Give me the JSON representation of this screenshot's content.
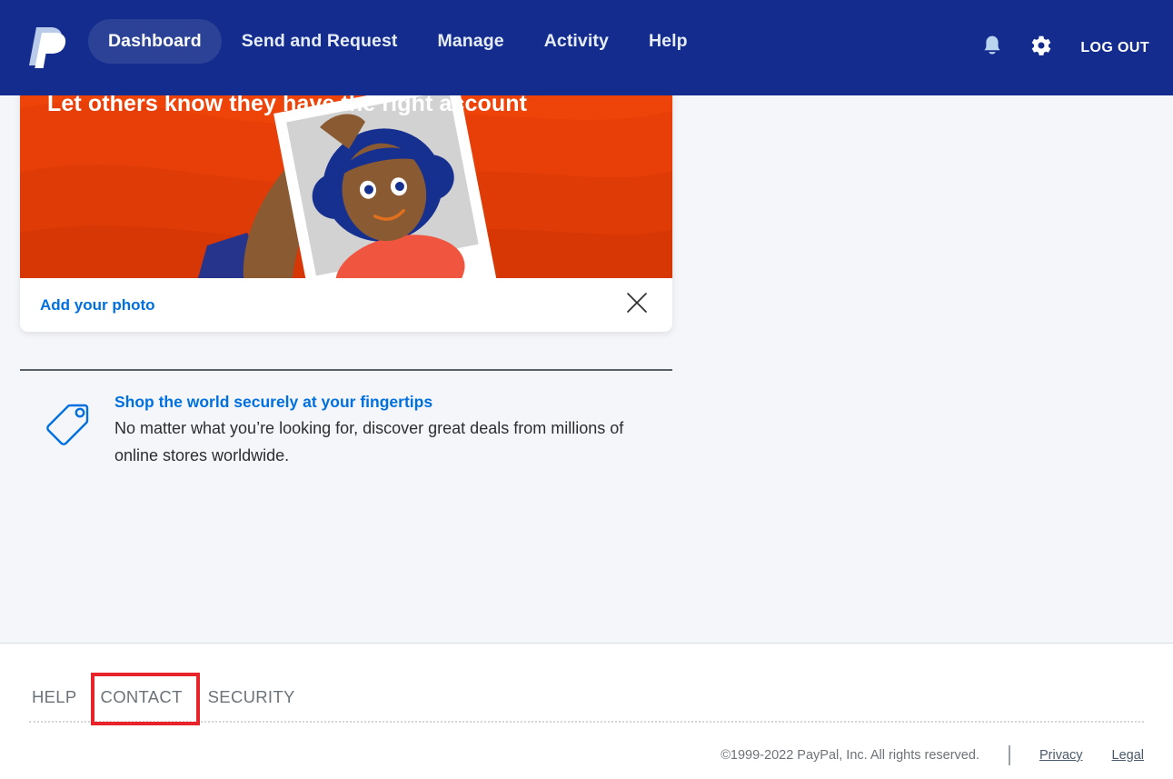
{
  "nav": {
    "logo": "paypal-logo",
    "items": [
      {
        "label": "Dashboard",
        "active": true
      },
      {
        "label": "Send and Request",
        "active": false
      },
      {
        "label": "Manage",
        "active": false
      },
      {
        "label": "Activity",
        "active": false
      },
      {
        "label": "Help",
        "active": false
      }
    ],
    "notifications_icon": "bell-icon",
    "settings_icon": "gear-icon",
    "logout_label": "LOG OUT",
    "background_color": "#142c8e",
    "active_pill_color": "#2b4296"
  },
  "promo": {
    "title": "Let others know they have the right account",
    "link_label": "Add your photo",
    "close_icon": "close-icon",
    "hero_color": "#ef4409"
  },
  "feature": {
    "icon": "price-tag-icon",
    "title": "Shop the world securely at your fingertips",
    "body": "No matter what you’re looking for, discover great deals from millions of online stores worldwide."
  },
  "footer": {
    "links": [
      {
        "label": "HELP"
      },
      {
        "label": "CONTACT"
      },
      {
        "label": "SECURITY"
      }
    ],
    "copyright": "©1999-2022 PayPal, Inc. All rights reserved.",
    "legal_links": [
      {
        "label": "Privacy"
      },
      {
        "label": "Legal"
      }
    ]
  },
  "annotation": {
    "highlight_target": "CONTACT",
    "highlight_color": "#e8232a"
  }
}
